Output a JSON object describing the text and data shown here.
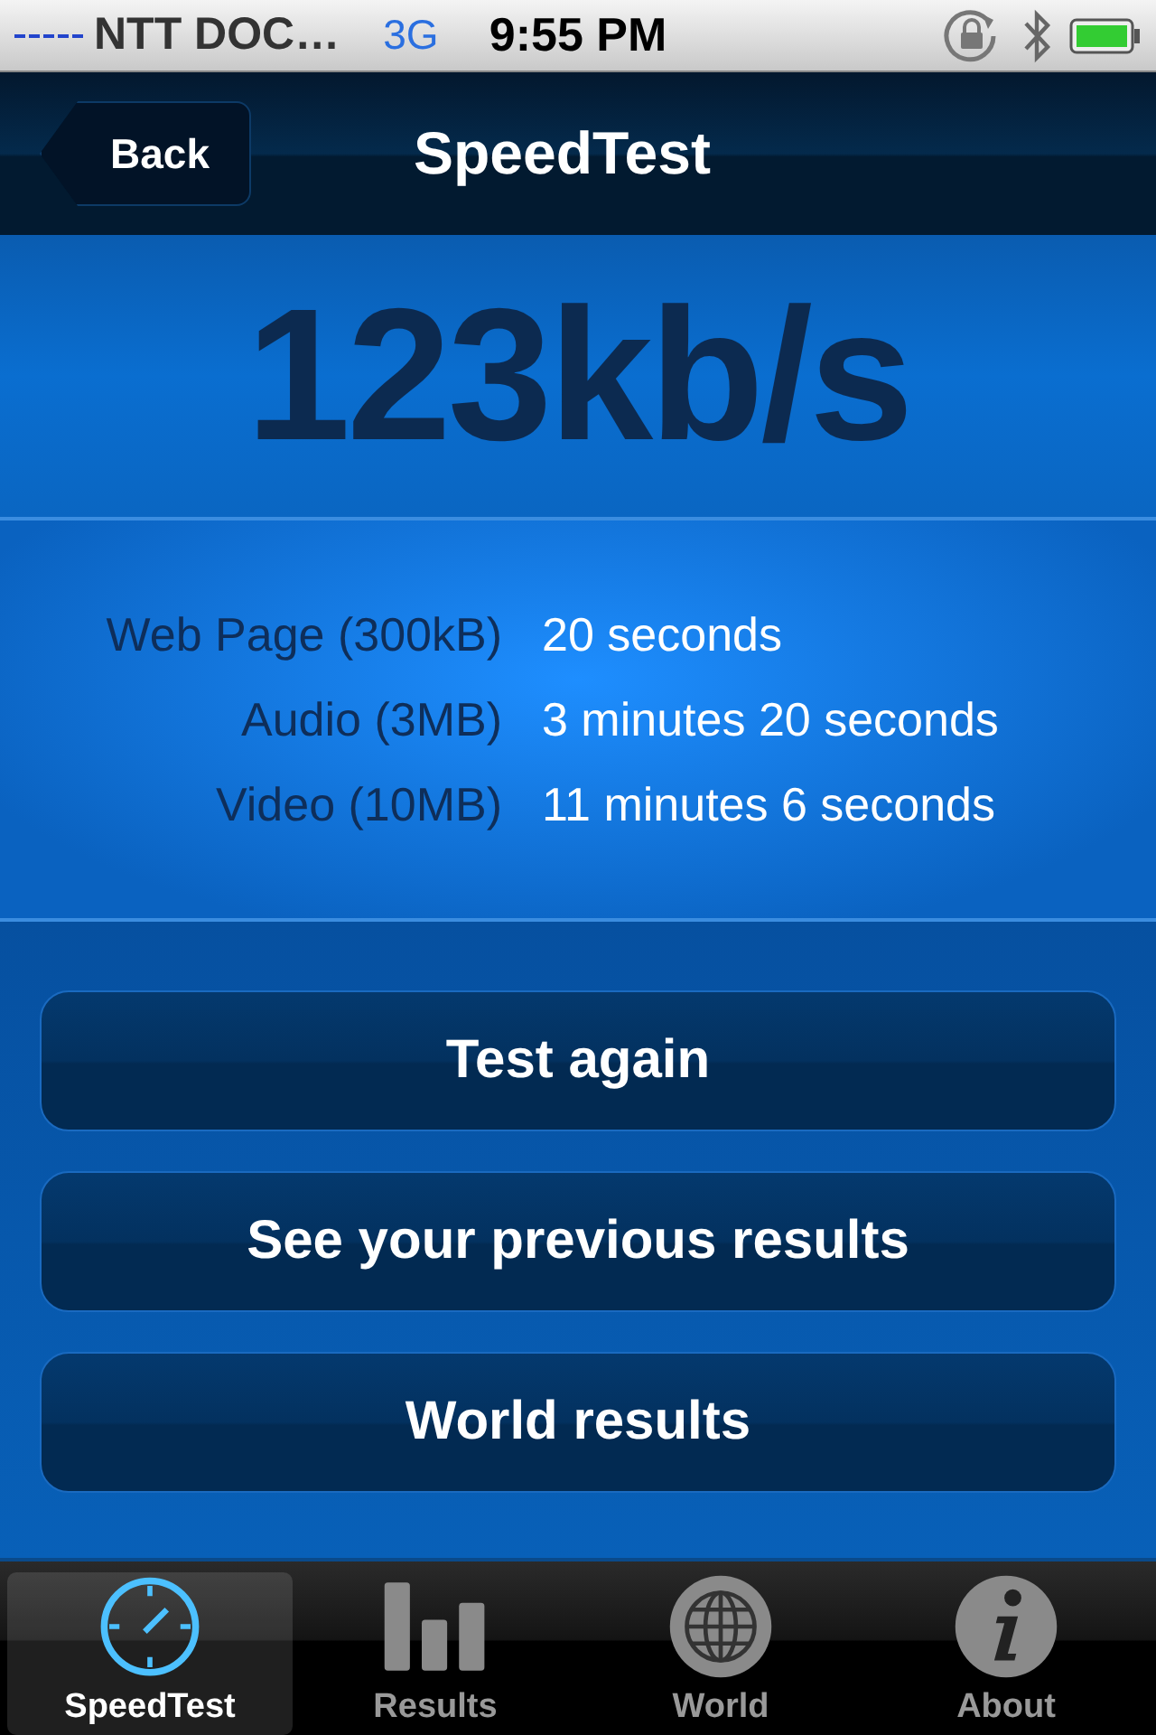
{
  "status_bar": {
    "carrier": "NTT DOC…",
    "network": "3G",
    "time": "9:55 PM"
  },
  "nav": {
    "back": "Back",
    "title": "SpeedTest"
  },
  "speed": "123kb/s",
  "estimates": [
    {
      "label": "Web Page (300kB)",
      "value": "20 seconds"
    },
    {
      "label": "Audio (3MB)",
      "value": "3 minutes 20 seconds"
    },
    {
      "label": "Video (10MB)",
      "value": "11 minutes 6 seconds"
    }
  ],
  "buttons": [
    "Test again",
    "See your previous results",
    "World results"
  ],
  "tabs": [
    {
      "label": "SpeedTest",
      "kind": "gauge",
      "selected": true
    },
    {
      "label": "Results",
      "kind": "bars",
      "selected": false
    },
    {
      "label": "World",
      "kind": "globe",
      "selected": false
    },
    {
      "label": "About",
      "kind": "info",
      "selected": false
    }
  ]
}
